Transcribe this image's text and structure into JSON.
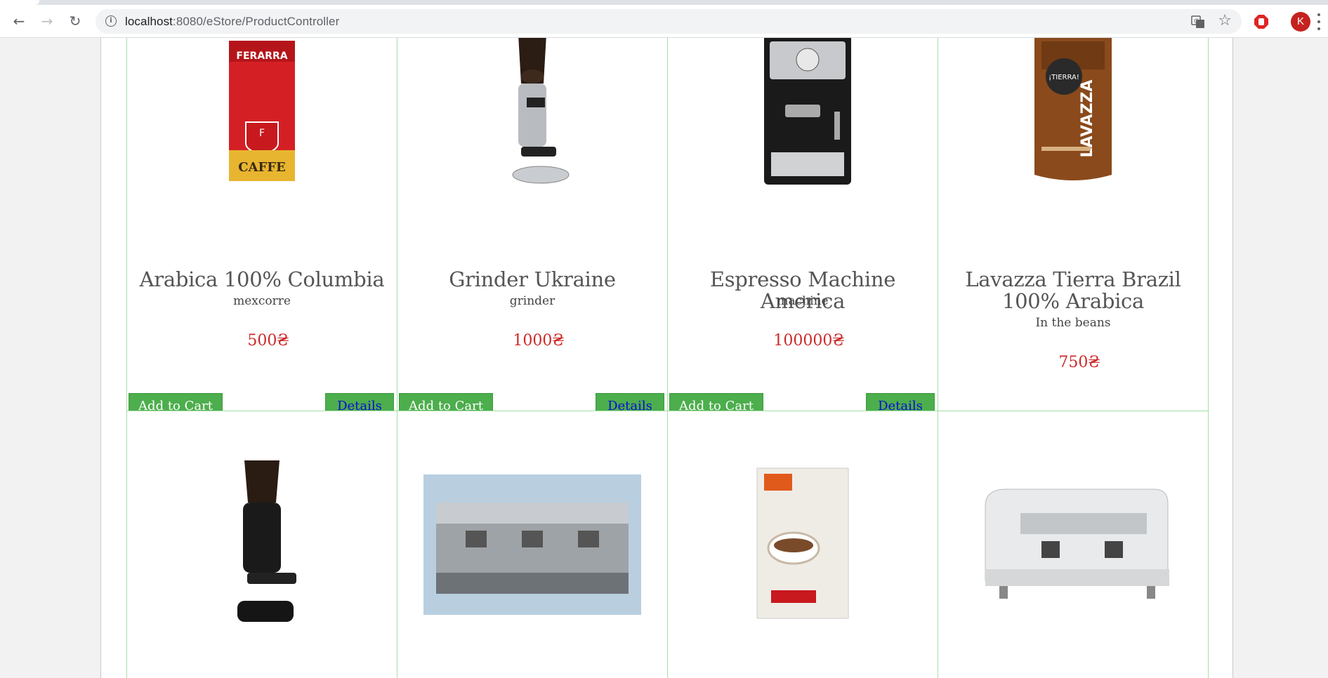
{
  "browser": {
    "url_host": "localhost",
    "url_path": ":8080/eStore/ProductController",
    "avatar_letter": "K"
  },
  "buttons": {
    "add_to_cart": "Add to Cart",
    "details": "Details"
  },
  "products_row1": [
    {
      "name": "Arabica 100% Columbia",
      "category": "mexcorre",
      "price": "500₴",
      "image": "coffee-bag-red-icon"
    },
    {
      "name": "Grinder Ukraine",
      "category": "grinder",
      "price": "1000₴",
      "image": "coffee-grinder-icon"
    },
    {
      "name": "Espresso Machine America",
      "category": "machine",
      "price": "100000₴",
      "image": "espresso-machine-icon"
    },
    {
      "name": "Lavazza Tierra Brazil 100% Arabica",
      "category": "In the beans",
      "price": "750₴",
      "image": "coffee-bag-brown-icon"
    }
  ],
  "products_row2": [
    {
      "image": "black-grinder-icon"
    },
    {
      "image": "commercial-espresso-machine-icon"
    },
    {
      "image": "malongo-coffee-bag-icon"
    },
    {
      "image": "white-espresso-machine-icon"
    }
  ],
  "colors": {
    "card_border": "#a6e0a6",
    "button_bg": "#4cae4c",
    "price": "#cc2a2a",
    "details_text": "#0b0bd6"
  }
}
